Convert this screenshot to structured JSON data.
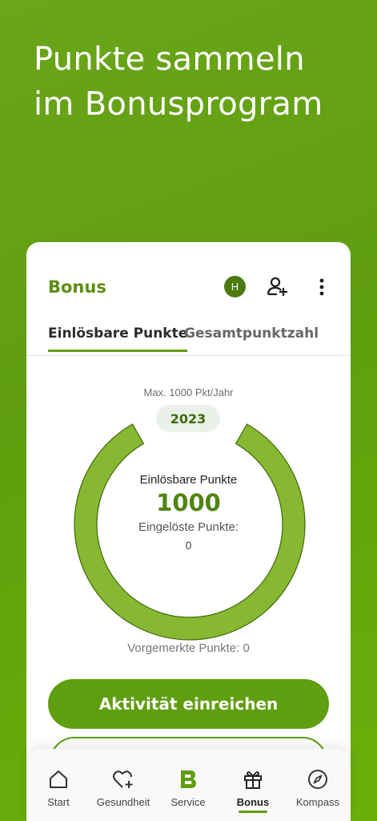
{
  "hero": {
    "title": "Punkte sammeln im Bonusprogram"
  },
  "card": {
    "title": "Bonus",
    "avatar_initial": "H",
    "tabs": [
      {
        "label": "Einlösbare Punkte",
        "active": true
      },
      {
        "label": "Gesamtpunktzahl",
        "active": false
      }
    ]
  },
  "progress": {
    "max_label": "Max. 1000 Pkt/Jahr",
    "year": "2023",
    "redeemable_label": "Einlösbare Punkte",
    "redeemable_value": "1000",
    "redeemed_label": "Eingelöste Punkte:",
    "redeemed_value": "0",
    "reserved_label": "Vorgemerkte Punkte: 0",
    "fill_fraction": 1.0
  },
  "actions": {
    "primary_label": "Aktivität einreichen"
  },
  "nav": {
    "items": [
      {
        "label": "Start",
        "icon": "home-icon"
      },
      {
        "label": "Gesundheit",
        "icon": "heart-plus-icon"
      },
      {
        "label": "Service",
        "icon": "brand-b-icon"
      },
      {
        "label": "Bonus",
        "icon": "gift-icon",
        "active": true
      },
      {
        "label": "Kompass",
        "icon": "compass-icon"
      }
    ]
  },
  "colors": {
    "brand_green": "#5f9e0e",
    "ring_fill": "#88b832",
    "ring_stroke": "#3f6b0a"
  }
}
